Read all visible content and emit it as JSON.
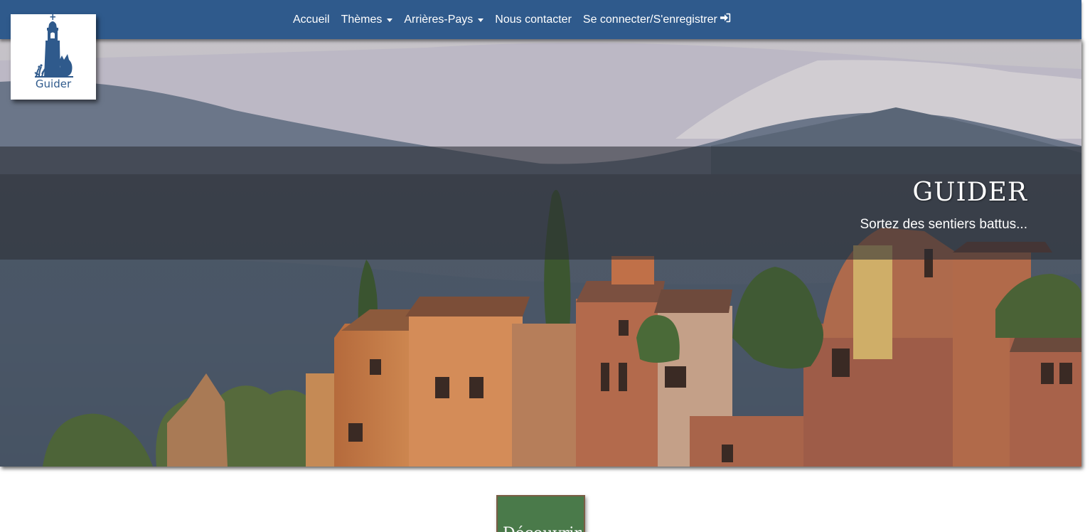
{
  "brand": {
    "logo_text": "Guider"
  },
  "nav": {
    "items": [
      {
        "label": "Accueil",
        "dropdown": false
      },
      {
        "label": "Thèmes",
        "dropdown": true
      },
      {
        "label": "Arrières-Pays",
        "dropdown": true
      },
      {
        "label": "Nous contacter",
        "dropdown": false
      },
      {
        "label": "Se connecter/S'enregistrer",
        "dropdown": false,
        "icon": "sign-in-icon"
      }
    ]
  },
  "hero": {
    "title": "GUIDER",
    "subtitle": "Sortez des sentiers battus...",
    "image": "provencal-hilltop-village"
  },
  "tile": {
    "label": "Découvrir"
  },
  "colors": {
    "navbar": "#2f5a8c",
    "tile": "#4a7a4a",
    "text": "#ffffff"
  }
}
